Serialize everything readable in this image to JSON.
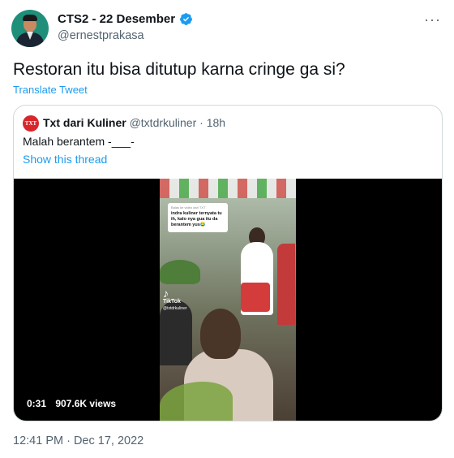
{
  "tweet": {
    "display_name": "CTS2 - 22 Desember",
    "handle": "@ernestprakasa",
    "text": "Restoran itu bisa ditutup karna cringe ga si?",
    "translate_label": "Translate Tweet",
    "timestamp": "12:41 PM · Dec 17, 2022",
    "more_icon": "···"
  },
  "quote": {
    "avatar_text": "TXT",
    "name": "Txt dari Kuliner",
    "handle_time": "@txtdrkuliner · 18h",
    "text": "Malah berantem -___-",
    "thread_label": "Show this thread"
  },
  "video": {
    "duration": "0:31",
    "views": "907.6K views",
    "watermark": "TikTok",
    "watermark_handle": "@txtdrkuliner",
    "caption_small": "Balas ke video dari TXT",
    "caption_main": "indra kuliner ternyata tu ih, kalo nya gua itu da berantem yus😂"
  },
  "colors": {
    "accent": "#1d9bf0",
    "secondary_text": "#536471",
    "border": "#cfd9de",
    "quote_avatar": "#d8262a"
  }
}
